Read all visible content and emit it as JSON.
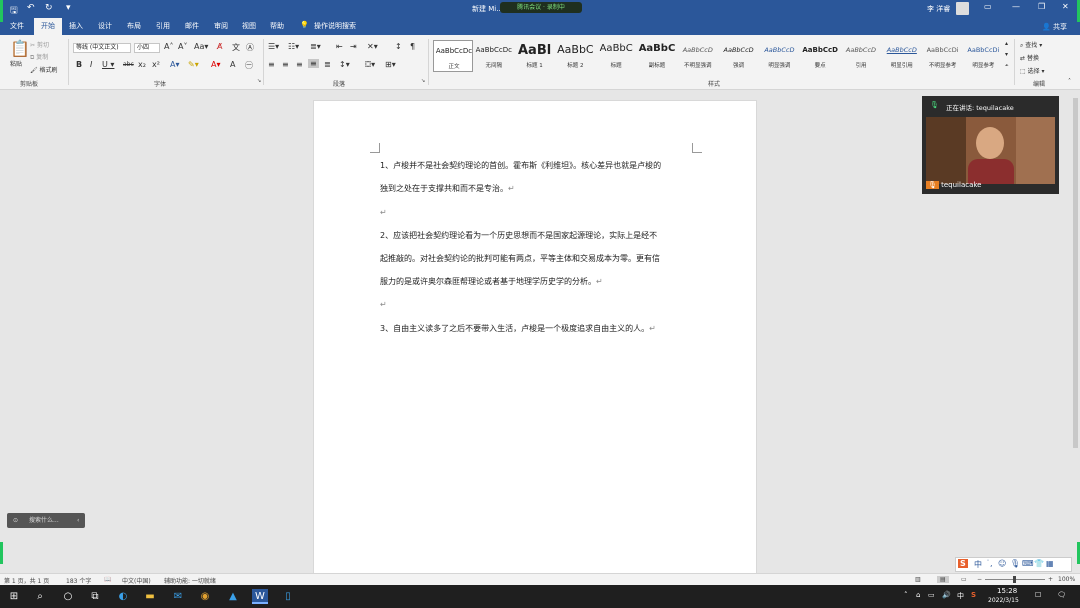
{
  "titlebar": {
    "doc_title": "新建 Mi... Word",
    "meeting_indicator": "腾讯会议 · 录制中",
    "user_name": "李 洋睿",
    "save_icon": "save-icon",
    "undo_icon": "undo-icon",
    "redo_icon": "redo-icon"
  },
  "tabs": [
    "文件",
    "开始",
    "插入",
    "设计",
    "布局",
    "引用",
    "邮件",
    "审阅",
    "视图",
    "帮助"
  ],
  "tell_me": "操作说明搜索",
  "share_label": "共享",
  "ribbon": {
    "clipboard": {
      "paste": "粘贴",
      "cut": "剪切",
      "copy": "复制",
      "format_painter": "格式刷",
      "group": "剪贴板"
    },
    "font": {
      "name": "等线 (中文正文)",
      "size": "小四",
      "group": "字体"
    },
    "paragraph": {
      "group": "段落"
    },
    "styles": {
      "group": "样式",
      "items": [
        {
          "preview": "AaBbCcDc",
          "name": "正文"
        },
        {
          "preview": "AaBbCcDc",
          "name": "无间隔"
        },
        {
          "preview": "AaBl",
          "name": "标题 1"
        },
        {
          "preview": "AaBbC",
          "name": "标题 2"
        },
        {
          "preview": "AaBbC",
          "name": "标题"
        },
        {
          "preview": "AaBbC",
          "name": "副标题"
        },
        {
          "preview": "AaBbCcD",
          "name": "不明显强调"
        },
        {
          "preview": "AaBbCcD",
          "name": "强调"
        },
        {
          "preview": "AaBbCcD",
          "name": "明显强调"
        },
        {
          "preview": "AaBbCcD",
          "name": "要点"
        },
        {
          "preview": "AaBbCcD",
          "name": "引用"
        },
        {
          "preview": "AaBbCcD",
          "name": "明显引用"
        },
        {
          "preview": "AaBbCcDi",
          "name": "不明显参考"
        },
        {
          "preview": "AaBbCcDi",
          "name": "明显参考"
        }
      ]
    },
    "editing": {
      "find": "查找",
      "replace": "替换",
      "select": "选择",
      "group": "编辑"
    }
  },
  "document": {
    "para1_line1": "1、卢梭并不是社会契约理论的首创。霍布斯《利维坦》。核心差异也就是卢梭的",
    "para1_line2": "独到之处在于支撑共和而不是专治。",
    "para2_line1": "2、应该把社会契约理论看为一个历史思想而不是国家起源理论，实际上是经不",
    "para2_line2": "起推敲的。对社会契约论的批判可能有两点，平等主体和交易成本为零。更有信",
    "para2_line3": "服力的是或许奥尔森匪帮理论或者基于地理学历史学的分析。",
    "para3_line1": "3、自由主义读多了之后不要带入生活，卢梭是一个极度追求自由主义的人。",
    "para_mark": "↵"
  },
  "video": {
    "speaking_label": "正在讲话: tequilacake",
    "participant_name": "tequilacake"
  },
  "search_popup": "搜索什么...",
  "statusbar": {
    "page_info": "第 1 页，共 1 页",
    "word_count": "183 个字",
    "language": "中文(中国)",
    "accessibility": "辅助功能: 一切就绪",
    "zoom": "100%"
  },
  "taskbar": {
    "time": "15:28",
    "date": "2022/3/15",
    "ime": "中"
  }
}
